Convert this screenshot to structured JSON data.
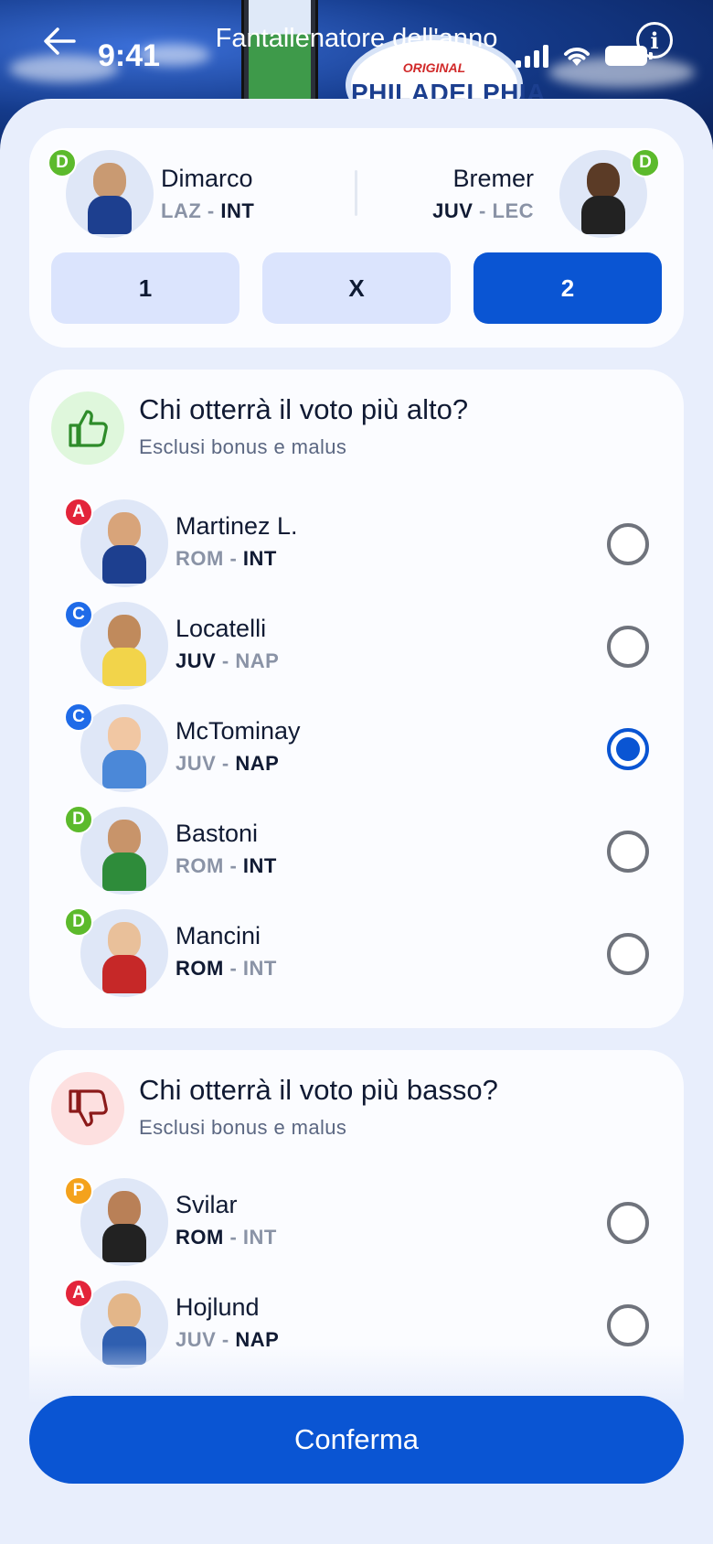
{
  "header": {
    "time": "9:41",
    "title": "Fantallenatore dell'anno",
    "brand_small": "ORIGINAL",
    "brand_name": "PHILADELPHIA"
  },
  "match": {
    "home": {
      "name": "Dimarco",
      "role": "D",
      "team_a": "LAZ",
      "team_b": "INT",
      "bold": "b"
    },
    "away": {
      "name": "Bremer",
      "role": "D",
      "team_a": "JUV",
      "team_b": "LEC",
      "bold": "a"
    },
    "options": [
      "1",
      "X",
      "2"
    ],
    "selected": "2"
  },
  "highest": {
    "title": "Chi otterrà il voto più alto?",
    "subtitle": "Esclusi bonus e malus",
    "players": [
      {
        "name": "Martinez L.",
        "role": "A",
        "team_a": "ROM",
        "team_b": "INT",
        "bold": "b",
        "checked": false
      },
      {
        "name": "Locatelli",
        "role": "C",
        "team_a": "JUV",
        "team_b": "NAP",
        "bold": "a",
        "checked": false
      },
      {
        "name": "McTominay",
        "role": "C",
        "team_a": "JUV",
        "team_b": "NAP",
        "bold": "b",
        "checked": true
      },
      {
        "name": "Bastoni",
        "role": "D",
        "team_a": "ROM",
        "team_b": "INT",
        "bold": "b",
        "checked": false
      },
      {
        "name": "Mancini",
        "role": "D",
        "team_a": "ROM",
        "team_b": "INT",
        "bold": "a",
        "checked": false
      }
    ]
  },
  "lowest": {
    "title": "Chi otterrà il voto più basso?",
    "subtitle": "Esclusi bonus e malus",
    "players": [
      {
        "name": "Svilar",
        "role": "P",
        "team_a": "ROM",
        "team_b": "INT",
        "bold": "a",
        "checked": false
      },
      {
        "name": "Hojlund",
        "role": "A",
        "team_a": "JUV",
        "team_b": "NAP",
        "bold": "b",
        "checked": false
      }
    ]
  },
  "confirm_label": "Conferma",
  "colors": {
    "primary": "#0a55d3",
    "role_P": "#f4a21c",
    "role_D": "#5cba2c",
    "role_C": "#1f6be8",
    "role_A": "#e3243a"
  }
}
